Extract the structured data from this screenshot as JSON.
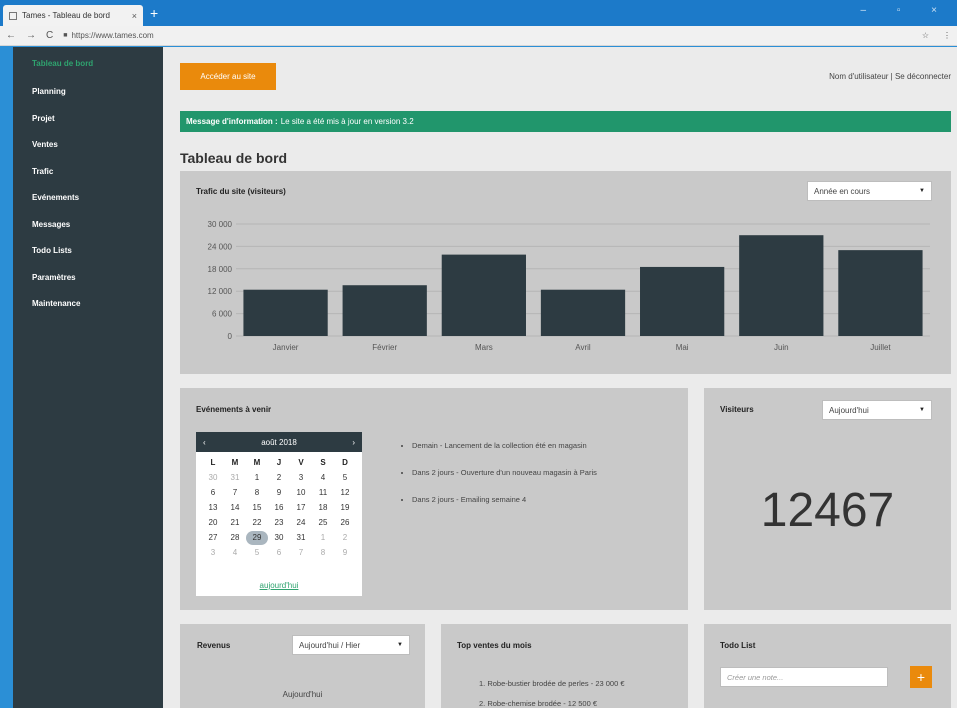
{
  "browser": {
    "tab_title": "Tames - Tableau de bord",
    "tab_close": "×",
    "new_tab": "+",
    "window_controls": "– ▫ ×",
    "url": "https://www.tames.com",
    "nav_back": "←",
    "nav_forward": "→",
    "nav_reload": "C",
    "star": "☆",
    "menu": "⋮"
  },
  "sidebar": {
    "items": [
      {
        "label": "Tableau de bord",
        "active": true
      },
      {
        "label": "Planning"
      },
      {
        "label": "Projet"
      },
      {
        "label": "Ventes"
      },
      {
        "label": "Trafic"
      },
      {
        "label": "Evénements"
      },
      {
        "label": "Messages"
      },
      {
        "label": "Todo Lists"
      },
      {
        "label": "Paramètres"
      },
      {
        "label": "Maintenance"
      }
    ]
  },
  "header": {
    "site_button": "Accéder au site",
    "user": "Nom d'utilisateur | Se déconnecter"
  },
  "info": {
    "label": "Message d'information :",
    "text": "Le site a été mis à jour en version 3.2"
  },
  "page_title": "Tableau de bord",
  "traffic": {
    "title": "Trafic du site (visiteurs)",
    "period_select": "Année en cours"
  },
  "chart_data": {
    "type": "bar",
    "categories": [
      "Janvier",
      "Février",
      "Mars",
      "Avril",
      "Mai",
      "Juin",
      "Juillet"
    ],
    "values": [
      12400,
      13600,
      21800,
      12400,
      18500,
      27000,
      23000
    ],
    "ylim": [
      0,
      30000
    ],
    "yticks": [
      "0",
      "6 000",
      "12 000",
      "18 000",
      "24 000",
      "30 000"
    ],
    "ytick_values": [
      0,
      6000,
      12000,
      18000,
      24000,
      30000
    ],
    "title": "",
    "xlabel": "",
    "ylabel": "",
    "grid": true,
    "bar_color": "#2d3b42"
  },
  "events": {
    "title": "Evénements à venir",
    "calendar": {
      "month": "août 2018",
      "prev": "‹",
      "next": "›",
      "day_headers": [
        "L",
        "M",
        "M",
        "J",
        "V",
        "S",
        "D"
      ],
      "days": [
        "30",
        "31",
        "1",
        "2",
        "3",
        "4",
        "5",
        "6",
        "7",
        "8",
        "9",
        "10",
        "11",
        "12",
        "13",
        "14",
        "15",
        "16",
        "17",
        "18",
        "19",
        "20",
        "21",
        "22",
        "23",
        "24",
        "25",
        "26",
        "27",
        "28",
        "29",
        "30",
        "31",
        "1",
        "2",
        "3",
        "4",
        "5",
        "6",
        "7",
        "8",
        "9"
      ],
      "today": "29",
      "today_link": "aujourd'hui"
    },
    "list": [
      "Demain - Lancement de la collection été en magasin",
      "Dans 2 jours - Ouverture d'un nouveau magasin à Paris",
      "Dans 2 jours - Emailing semaine 4"
    ]
  },
  "visitors": {
    "title": "Visiteurs",
    "select": "Aujourd'hui",
    "count": "12467"
  },
  "revenue": {
    "title": "Revenus",
    "select": "Aujourd'hui / Hier",
    "label": "Aujourd'hui"
  },
  "top_sales": {
    "title": "Top ventes du mois",
    "items": [
      "1. Robe-bustier brodée de perles - 23 000 €",
      "2. Robe-chemise brodée - 12 500 €"
    ]
  },
  "todo": {
    "title": "Todo List",
    "placeholder": "Créer une note...",
    "add": "+"
  },
  "colors": {
    "sidebar": "#2d3b42",
    "accent_orange": "#ea8a0c",
    "accent_green": "#21966c",
    "panel": "#c9c9c9"
  }
}
